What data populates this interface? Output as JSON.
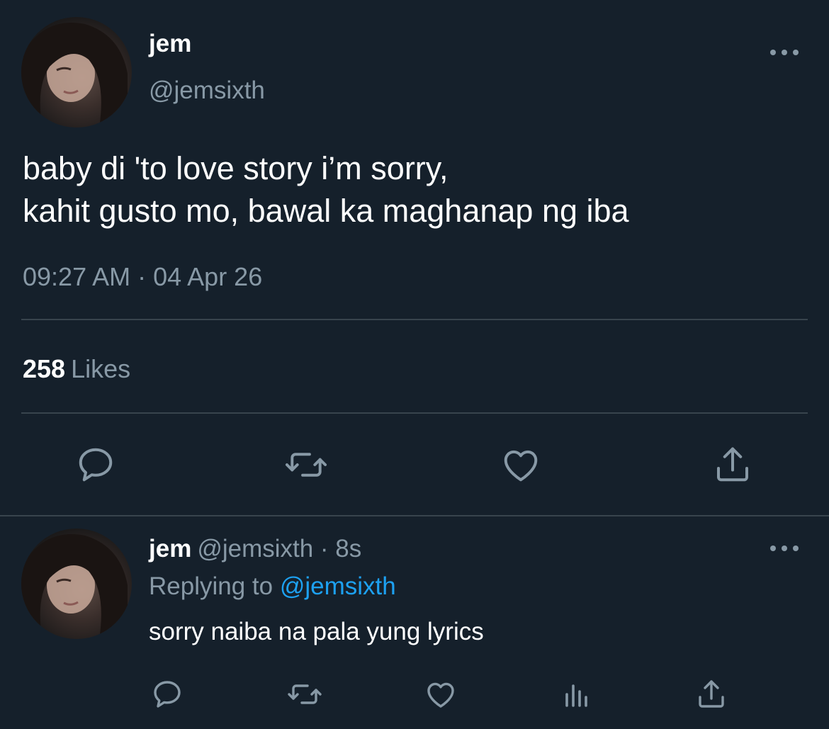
{
  "tweet": {
    "author_name": "jem",
    "author_handle": "@jemsixth",
    "text": "baby di 'to love story i’m sorry,\nkahit gusto mo, bawal ka maghanap ng iba",
    "timestamp": "09:27 AM · 04 Apr 26",
    "likes_count": "258",
    "likes_label": "Likes",
    "avatar_icon": "profile-photo",
    "actions": [
      "reply-icon",
      "retweet-icon",
      "like-icon",
      "share-icon"
    ]
  },
  "reply": {
    "author_name": "jem",
    "author_handle": "@jemsixth · 8s",
    "replying_prefix": "Replying to",
    "replying_to": "@jemsixth",
    "text": "sorry naiba na pala yung lyrics",
    "actions": [
      "reply-icon",
      "retweet-icon",
      "like-icon",
      "analytics-icon",
      "share-icon"
    ]
  },
  "colors": {
    "background": "#15202b",
    "muted": "#8899a6",
    "link": "#1da1f2",
    "divider": "#38444d"
  }
}
